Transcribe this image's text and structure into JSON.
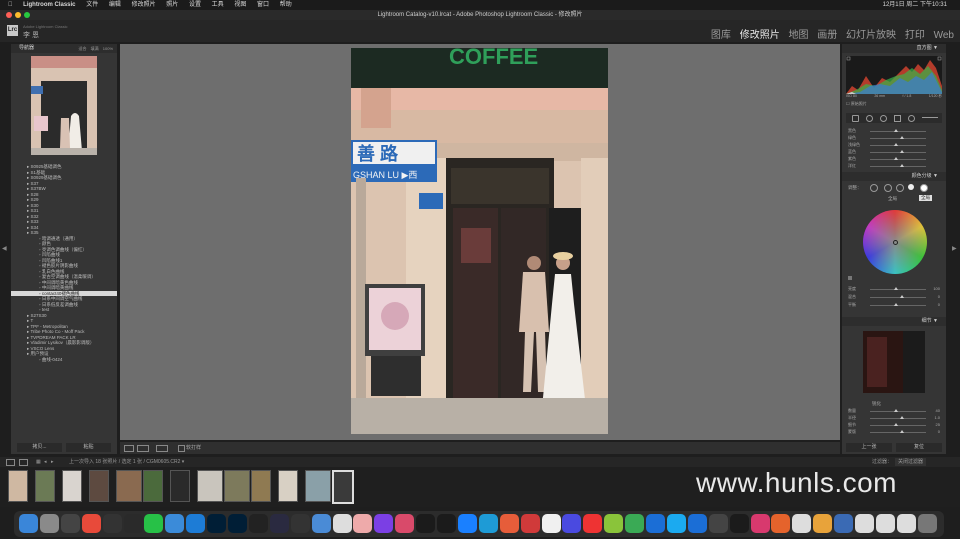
{
  "menubar": {
    "app": "Lightroom Classic",
    "items": [
      "文件",
      "编辑",
      "修改照片",
      "照片",
      "设置",
      "工具",
      "视图",
      "窗口",
      "帮助"
    ],
    "clock": "12月1日 周二 下午10:31"
  },
  "window": {
    "title": "Lightroom Catalog-v10.lrcat - Adobe Photoshop Lightroom Classic - 修改照片"
  },
  "lrheader": {
    "logo": "Lrc",
    "user": "李 恩",
    "subtitle": "Adobe Lightroom Classic"
  },
  "modules": [
    "图库",
    "修改照片",
    "地图",
    "画册",
    "幻灯片放映",
    "打印",
    "Web"
  ],
  "left_panel": {
    "navigator_title": "导航器",
    "navigator_zoom": [
      "适合",
      "填满",
      "100%"
    ],
    "presets": [
      {
        "label": "S0925基础调色",
        "type": "group"
      },
      {
        "label": "S1基础",
        "type": "group"
      },
      {
        "label": "S0929基础调色",
        "type": "group"
      },
      {
        "label": "S37",
        "type": "group"
      },
      {
        "label": "S37BW",
        "type": "group"
      },
      {
        "label": "S28",
        "type": "group"
      },
      {
        "label": "S29",
        "type": "group"
      },
      {
        "label": "S30",
        "type": "group"
      },
      {
        "label": "S31",
        "type": "group"
      },
      {
        "label": "S32",
        "type": "group"
      },
      {
        "label": "S33",
        "type": "group"
      },
      {
        "label": "S34",
        "type": "group"
      },
      {
        "label": "S35",
        "type": "group"
      },
      {
        "label": "暗调通透（通用）",
        "type": "item"
      },
      {
        "label": "颜色",
        "type": "item"
      },
      {
        "label": "亮调色调曲线（偏红）",
        "type": "item"
      },
      {
        "label": "凹陷曲线",
        "type": "item"
      },
      {
        "label": "凹陷曲线1",
        "type": "item"
      },
      {
        "label": "褪色胶片阴影曲线",
        "type": "item"
      },
      {
        "label": "乳白色曲线",
        "type": "item"
      },
      {
        "label": "复古空调曲线（温柔暖调）",
        "type": "item"
      },
      {
        "label": "中间调暗黄色曲线",
        "type": "item"
      },
      {
        "label": "中间调暗黄曲线",
        "type": "item"
      },
      {
        "label": "contact40褪色曲线",
        "type": "selected"
      },
      {
        "label": "日系中间调空气曲线",
        "type": "item"
      },
      {
        "label": "日系低反差调曲线",
        "type": "item"
      },
      {
        "label": "test",
        "type": "item"
      },
      {
        "label": "S27S30",
        "type": "group"
      },
      {
        "label": "T",
        "type": "group"
      },
      {
        "label": "TPF - Metropolitan",
        "type": "group"
      },
      {
        "label": "Tribe Photo Co - Moff Pack",
        "type": "group"
      },
      {
        "label": "TVPDREAM PACK LR",
        "type": "group"
      },
      {
        "label": "Vladimir Lysikov（晨影影调版）",
        "type": "group"
      },
      {
        "label": "VSCO Lens",
        "type": "group"
      },
      {
        "label": "用户预设",
        "type": "group"
      },
      {
        "label": "曲线-0424",
        "type": "item"
      }
    ],
    "copy_button": "拷贝...",
    "paste_button": "粘贴"
  },
  "toolbar": {
    "soft_proof_label": "软打样"
  },
  "right_panel": {
    "histogram_title": "直方图",
    "histogram_readout": [
      "ISO 80",
      "26 mm",
      "f / 1.8",
      "1/120 秒"
    ],
    "original_photo_label": "原始照片",
    "hsl_rows": [
      "黑色",
      "绿色",
      "浅绿色",
      "蓝色",
      "紫色",
      "洋红"
    ],
    "color_grading_title": "颜色分级",
    "color_grading_mode": "调整：",
    "color_grading_view": "全局",
    "tooltip": "全局",
    "cg_sliders": [
      "亮度",
      "混合",
      "平衡"
    ],
    "cg_values": [
      "100",
      "0",
      "0"
    ],
    "detail_title": "细节",
    "detail_section": "锐化",
    "detail_sliders": [
      "数量",
      "半径",
      "细节",
      "蒙版"
    ],
    "detail_values": [
      "40",
      "1.0",
      "25",
      "0"
    ],
    "prev_button": "上一张",
    "reset_button": "复位"
  },
  "filmstrip": {
    "info": "上一次导入   18 张照片 / 选定 1 张 / CGM0605.CR2 ▾",
    "filter_label": "过滤器：",
    "filter_value": "关闭过滤器",
    "thumbnail_count": 13
  },
  "watermark": {
    "text": "www.hunls.com"
  },
  "colors": {
    "accent": "#d8d8d8",
    "panel": "#353535",
    "workspace": "#6e6e6e",
    "dock_icons": [
      "#3a86d9",
      "#8a8a8a",
      "#444",
      "#e84a3a",
      "#333",
      "#2a2a2a",
      "#27c147",
      "#3b8bd9",
      "#1d7cd6",
      "#001e36",
      "#001e36",
      "#222",
      "#2a2a40",
      "#333",
      "#4a8bd6",
      "#ddd",
      "#eaa",
      "#7b3fe4",
      "#d94a6a",
      "#1b1b1b",
      "#1b1b1b",
      "#1a80ff",
      "#1e9bd6",
      "#e65d3a",
      "#d03a3a",
      "#f0f0f0",
      "#4a4ae0",
      "#e33",
      "#8ac43a",
      "#3aaa55",
      "#1b6ed6",
      "#1baaf0",
      "#1b6ed6",
      "#444",
      "#1b1b1b",
      "#d8396e",
      "#e5632c",
      "#ddd",
      "#e8a33a",
      "#3a6ab4",
      "#ddd",
      "#ddd",
      "#ddd",
      "#777"
    ]
  }
}
